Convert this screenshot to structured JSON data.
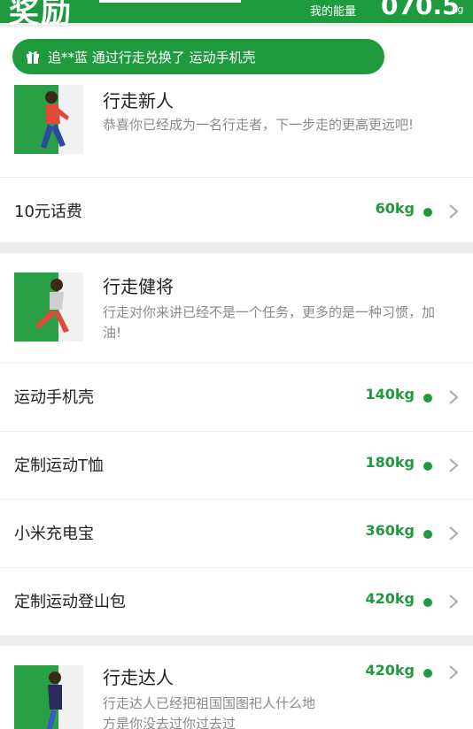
{
  "header": {
    "title": "奖励",
    "energy_label": "我的能量",
    "energy_value": "070.5",
    "energy_unit": "kg"
  },
  "banner": {
    "text": "追**蓝 通过行走兑换了 运动手机壳",
    "icon": "gift-icon"
  },
  "levels": [
    {
      "title": "行走新人",
      "desc": "恭喜你已经成为一名行走者，下一步走的更高更远吧!",
      "items": [
        {
          "name": "10元话费",
          "price": "60kg"
        }
      ]
    },
    {
      "title": "行走健将",
      "desc": "行走对你来讲已经不是一个任务，更多的是一种习惯，加油!",
      "items": [
        {
          "name": "运动手机壳",
          "price": "140kg"
        },
        {
          "name": "定制运动T恤",
          "price": "180kg"
        },
        {
          "name": "小米充电宝",
          "price": "360kg"
        },
        {
          "name": "定制运动登山包",
          "price": "420kg"
        }
      ]
    },
    {
      "title": "行走达人",
      "desc": "行走达人已经把祖国国图祀人什么地方是你没去过你过去过",
      "price": "420kg"
    }
  ],
  "colors": {
    "brand_green": "#1f9a3e",
    "background": "#ececec",
    "card": "#ffffff",
    "muted_text": "#8a8a8a"
  }
}
